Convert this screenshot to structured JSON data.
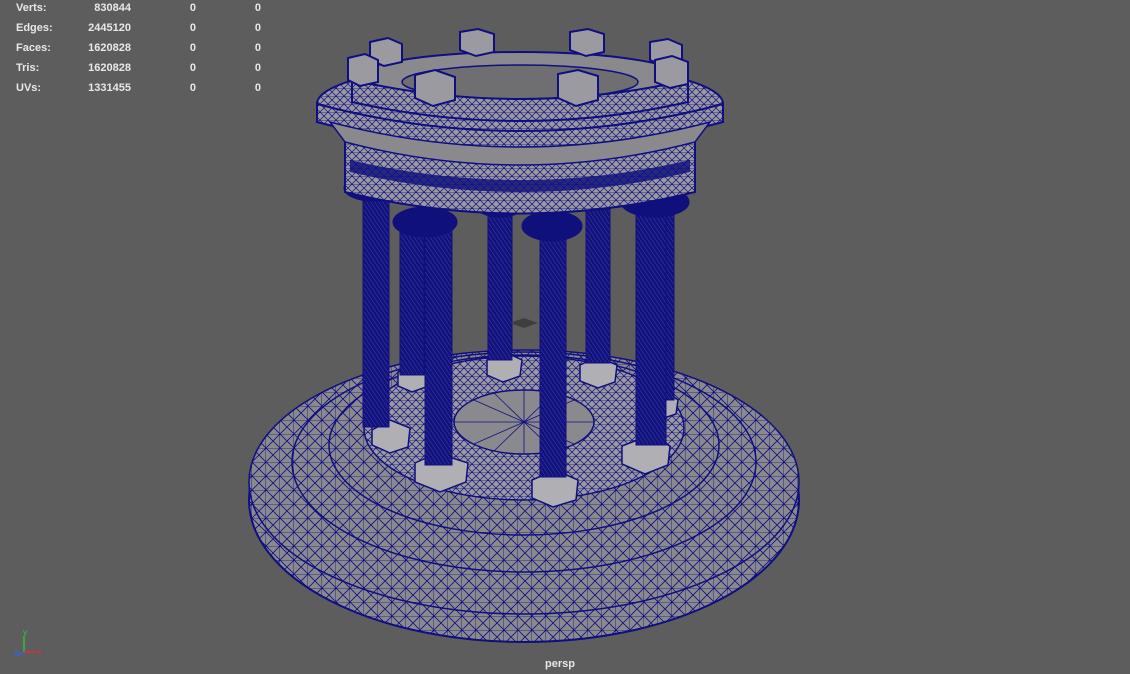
{
  "hud": {
    "rows": [
      {
        "label": "Verts:",
        "values": [
          "830844",
          "0",
          "0"
        ]
      },
      {
        "label": "Edges:",
        "values": [
          "2445120",
          "0",
          "0"
        ]
      },
      {
        "label": "Faces:",
        "values": [
          "1620828",
          "0",
          "0"
        ]
      },
      {
        "label": "Tris:",
        "values": [
          "1620828",
          "0",
          "0"
        ]
      },
      {
        "label": "UVs:",
        "values": [
          "1331455",
          "0",
          "0"
        ]
      }
    ]
  },
  "camera": {
    "name": "persp"
  },
  "axis_gizmo": {
    "x": "x",
    "y": "y",
    "z": "z"
  },
  "colors": {
    "background": "#5d5d5d",
    "wireframe": "#0f0f80",
    "surface": "#8a8a8e",
    "hud_text": "#e8e8e8",
    "axis_x": "#e03030",
    "axis_y": "#30c030",
    "axis_z": "#3060ff"
  }
}
